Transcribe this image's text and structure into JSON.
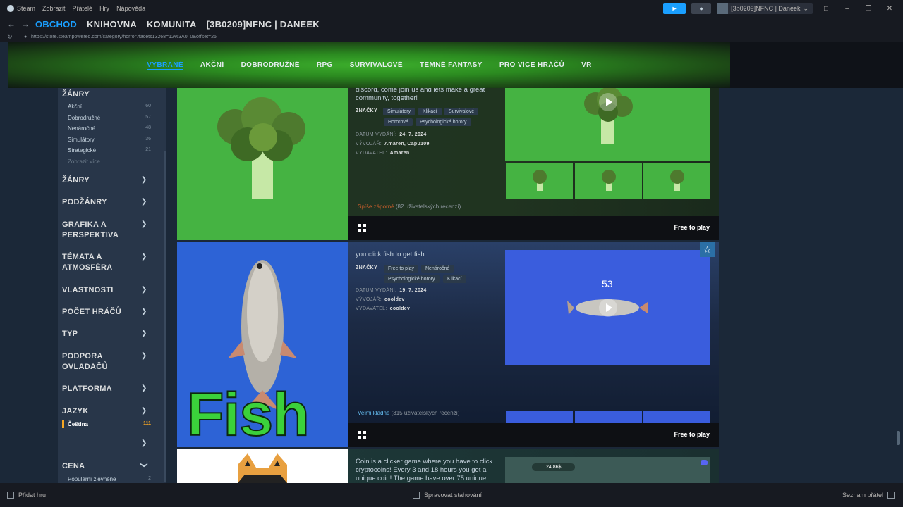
{
  "titlebar": {
    "menu": [
      "Steam",
      "Zobrazit",
      "Přátelé",
      "Hry",
      "Nápověda"
    ],
    "username": "[3b0209]NFNC | Daneek"
  },
  "nav": {
    "tabs": [
      "OBCHOD",
      "KNIHOVNA",
      "KOMUNITA",
      "[3B0209]NFNC | DANEEK"
    ]
  },
  "url": "https://store.steampowered.com/category/horror?facets13268=12%3A0_0&offset=25",
  "store_nav": [
    "VYBRANÉ",
    "AKČNÍ",
    "DOBRODRUŽNÉ",
    "RPG",
    "SURVIVALOVÉ",
    "TEMNÉ FANTASY",
    "PRO VÍCE HRÁČŮ",
    "VR"
  ],
  "sidebar": {
    "top_section": "ŽÁNRY",
    "genre_items": [
      {
        "label": "Akční",
        "count": "60"
      },
      {
        "label": "Dobrodružné",
        "count": "57"
      },
      {
        "label": "Nenáročné",
        "count": "48"
      },
      {
        "label": "Simulátory",
        "count": "36"
      },
      {
        "label": "Strategické",
        "count": "21"
      }
    ],
    "show_more": "Zobrazit více",
    "sections": [
      "ŽÁNRY",
      "PODŽÁNRY",
      "GRAFIKA A PERSPEKTIVA",
      "TÉMATA A ATMOSFÉRA",
      "VLASTNOSTI",
      "POČET HRÁČŮ",
      "TYP",
      "PODPORA OVLADAČŮ",
      "PLATFORMA",
      "JAZYK"
    ],
    "language_selected": {
      "label": "Čeština",
      "count": "111"
    },
    "price_section": "CENA",
    "price_item": {
      "label": "Populární zlevněné",
      "count": "2"
    }
  },
  "results": [
    {
      "desc": "discord, come join us and lets make a great community, together!",
      "tags_label": "ZNAČKY",
      "tags": [
        "Simulátory",
        "Klikací",
        "Survivalové",
        "Hororové",
        "Psychologické horory"
      ],
      "release_label": "DATUM VYDÁNÍ:",
      "release": "24. 7. 2024",
      "dev_label": "VÝVOJÁŘ:",
      "dev": "Amaren, Capu109",
      "pub_label": "VYDAVATEL:",
      "pub": "Amaren",
      "review": "Spíše záporné",
      "review_count": "(82 uživatelských recenzí)",
      "review_color": "#c35c2c",
      "price": "Free to play"
    },
    {
      "desc": "you click fish to get fish.",
      "tags_label": "ZNAČKY",
      "tags": [
        "Free to play",
        "Nenáročné",
        "Psychologické horory",
        "Klikací"
      ],
      "release_label": "DATUM VYDÁNÍ:",
      "release": "19. 7. 2024",
      "dev_label": "VÝVOJÁŘ:",
      "dev": "cooldev",
      "pub_label": "VYDAVATEL:",
      "pub": "cooldev",
      "review": "Velmi kladné",
      "review_count": "(315 uživatelských recenzí)",
      "review_color": "#66c0f4",
      "price": "Free to play",
      "capsule_text": "Fish",
      "screenshot_counter": "53"
    },
    {
      "desc": "Coin is a clicker game where you have to click cryptocoins! Every 3 and 18 hours you get a unique coin! The game have over 75 unique",
      "screenshot_value": "24,86$"
    }
  ],
  "footer": {
    "add_game": "Přidat hru",
    "downloads": "Spravovat stahování",
    "friends": "Seznam přátel"
  },
  "colors": {
    "accent": "#1a9fff",
    "background": "#1b2838",
    "sidebar": "#283649"
  }
}
